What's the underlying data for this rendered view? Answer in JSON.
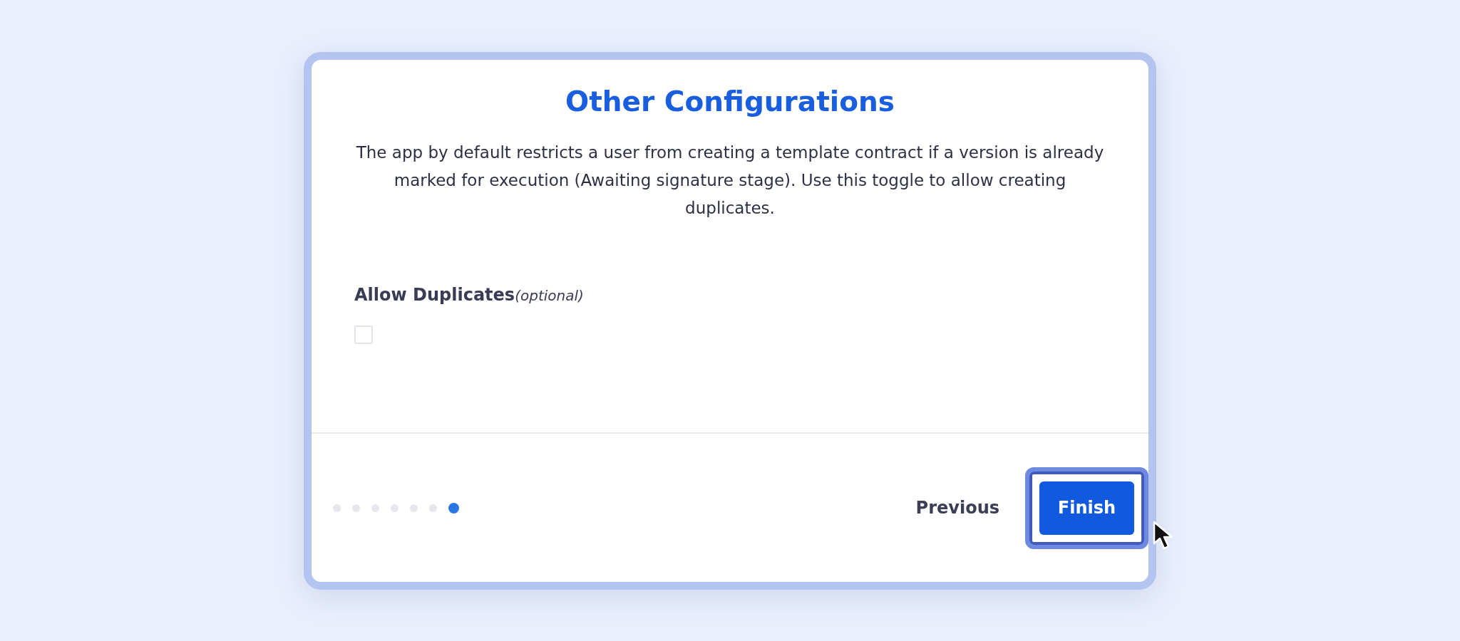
{
  "dialog": {
    "title": "Other Configurations",
    "description": "The app by default restricts a user from creating a template contract if a version is already marked for execution (Awaiting signature stage). Use this toggle to allow creating duplicates.",
    "field": {
      "label": "Allow Duplicates",
      "hint": "(optional)",
      "checked": false
    },
    "steps": [
      {
        "selected": false
      },
      {
        "selected": false
      },
      {
        "selected": false
      },
      {
        "selected": false
      },
      {
        "selected": false
      },
      {
        "selected": false
      },
      {
        "selected": true
      }
    ],
    "buttons": {
      "previous": "Previous",
      "finish": "Finish",
      "finish_highlighted": true
    }
  }
}
